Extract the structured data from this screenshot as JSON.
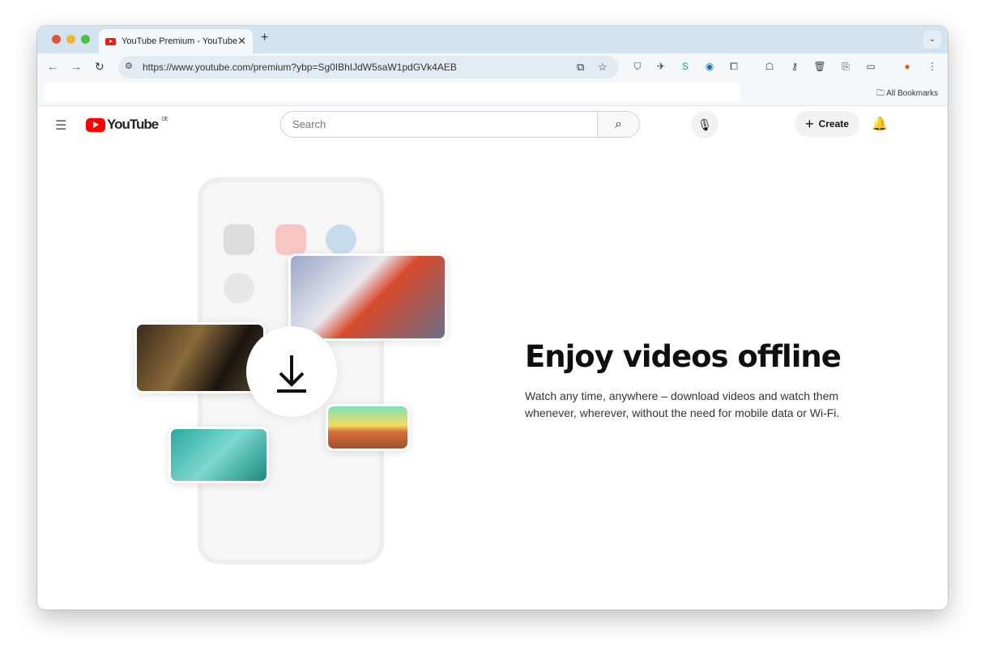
{
  "browser": {
    "tab_title": "YouTube Premium - YouTube",
    "url": "https://www.youtube.com/premium?ybp=Sg0IBhIJdW5saW1pdGVk4AEB",
    "all_bookmarks": "All Bookmarks"
  },
  "youtube": {
    "logo": "YouTube",
    "region": "DE",
    "search_placeholder": "Search",
    "create_label": "Create"
  },
  "hero": {
    "title": "Enjoy videos offline",
    "description": "Watch any time, anywhere – download videos and watch them whenever, wherever, without the need for mobile data or Wi-Fi."
  }
}
